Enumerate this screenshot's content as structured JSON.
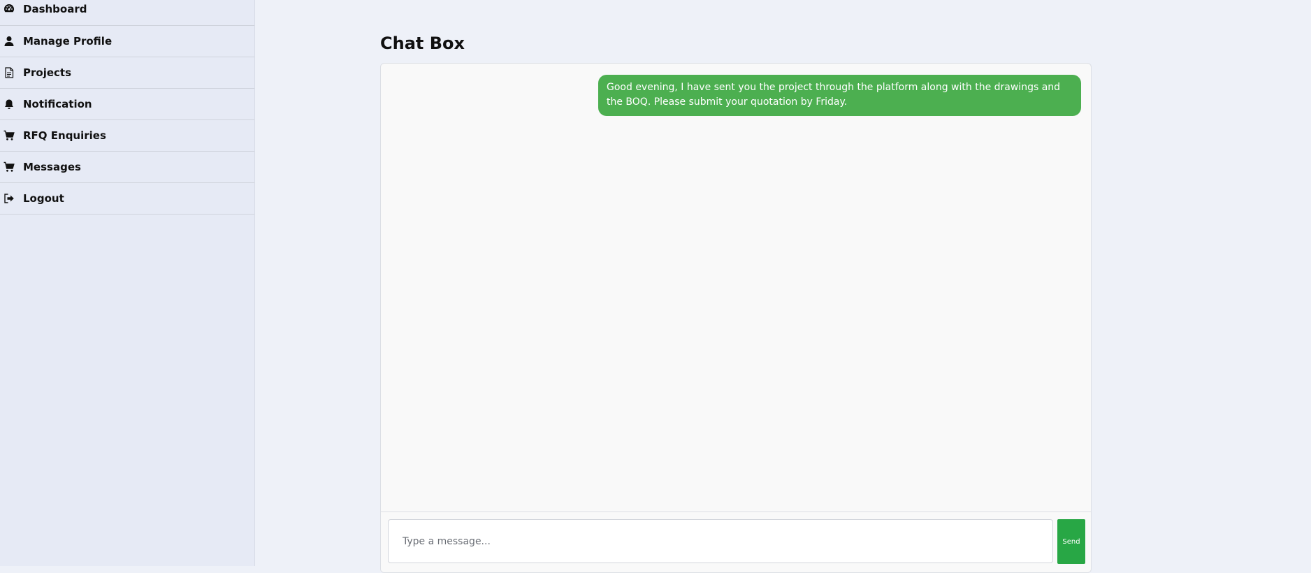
{
  "sidebar": {
    "items": [
      {
        "label": "Dashboard",
        "icon": "dashboard-icon"
      },
      {
        "label": "Manage Profile",
        "icon": "user-icon"
      },
      {
        "label": "Projects",
        "icon": "document-icon"
      },
      {
        "label": "Notification",
        "icon": "bell-icon"
      },
      {
        "label": "RFQ Enquiries",
        "icon": "cart-icon"
      },
      {
        "label": "Messages",
        "icon": "cart-icon"
      },
      {
        "label": "Logout",
        "icon": "logout-icon"
      }
    ]
  },
  "main": {
    "title": "Chat Box",
    "messages": [
      {
        "text": "Good evening, I have sent you the project through the platform along with the drawings and the BOQ. Please submit your quotation by Friday.",
        "sender": "self"
      }
    ],
    "composer": {
      "placeholder": "Type a message...",
      "value": "",
      "send_label": "Send"
    }
  },
  "colors": {
    "page_background": "#eef1f8",
    "sidebar_background": "#e6eaf5",
    "bubble": "#4caf50",
    "send_button": "#28a745"
  }
}
